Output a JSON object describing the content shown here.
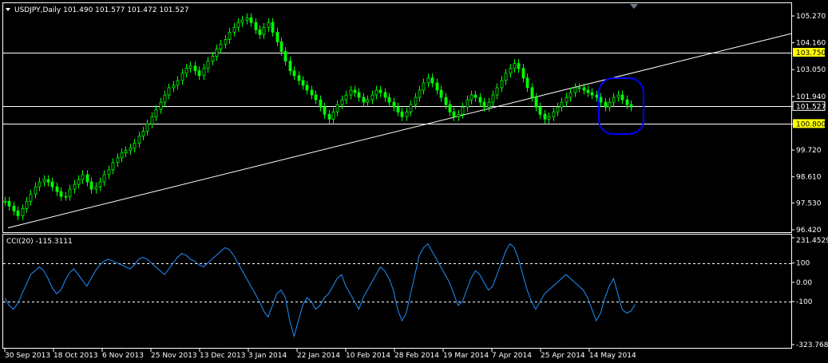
{
  "header": {
    "symbol_line": "USDJPY,Daily  101.490 101.577 101.472 101.527",
    "menu_arrow_icon": "triangle-down-icon"
  },
  "indicator": {
    "label": "CCI(20) -115.3111",
    "axis_labels": [
      "231.4529",
      "100",
      "0.00",
      "-100",
      "-323.768"
    ]
  },
  "price_axis": {
    "labels": [
      "105.270",
      "104.160",
      "103.050",
      "101.940",
      "101.527",
      "100.800",
      "99.720",
      "98.610",
      "97.530",
      "96.420"
    ],
    "highlighted": [
      "103.750",
      "100.800"
    ],
    "current_price_label": "101.527"
  },
  "time_axis": {
    "labels": [
      "30 Sep 2013",
      "18 Oct 2013",
      "6 Nov 2013",
      "25 Nov 2013",
      "13 Dec 2013",
      "3 Jan 2014",
      "22 Jan 2014",
      "10 Feb 2014",
      "28 Feb 2014",
      "19 Mar 2014",
      "7 Apr 2014",
      "25 Apr 2014",
      "14 May 2014"
    ]
  },
  "colors": {
    "background": "#000000",
    "candle": "#00ff00",
    "grid_line": "#ffffff",
    "cci_line": "#1e90ff",
    "annotation_circle": "#0000ff",
    "highlight_box": "#ffff00"
  },
  "chart_data": {
    "type": "line",
    "series": [
      {
        "name": "USDJPY",
        "values": [
          97.6,
          97.4,
          97.2,
          97.0,
          97.3,
          97.6,
          97.9,
          98.2,
          98.4,
          98.5,
          98.4,
          98.2,
          98.0,
          97.8,
          97.8,
          98.1,
          98.3,
          98.5,
          98.7,
          98.4,
          98.1,
          98.2,
          98.4,
          98.7,
          98.9,
          99.2,
          99.4,
          99.6,
          99.7,
          99.8,
          100.0,
          100.3,
          100.5,
          100.8,
          101.1,
          101.4,
          101.7,
          102.0,
          102.3,
          102.4,
          102.6,
          102.9,
          103.1,
          103.2,
          103.0,
          102.8,
          103.1,
          103.4,
          103.6,
          103.9,
          104.1,
          104.3,
          104.6,
          104.8,
          105.0,
          105.1,
          105.2,
          105.0,
          104.7,
          104.5,
          104.8,
          105.0,
          104.6,
          104.2,
          103.8,
          103.4,
          103.0,
          102.8,
          102.6,
          102.4,
          102.2,
          102.0,
          101.8,
          101.5,
          101.2,
          101.0,
          101.3,
          101.6,
          101.8,
          102.0,
          102.2,
          102.1,
          101.9,
          101.7,
          101.8,
          102.0,
          102.2,
          102.1,
          101.9,
          101.7,
          101.5,
          101.3,
          101.1,
          101.3,
          101.6,
          101.9,
          102.2,
          102.5,
          102.7,
          102.5,
          102.2,
          101.9,
          101.6,
          101.3,
          101.1,
          101.2,
          101.5,
          101.8,
          102.0,
          101.9,
          101.7,
          101.5,
          101.7,
          102.0,
          102.3,
          102.6,
          102.9,
          103.1,
          103.3,
          103.1,
          102.7,
          102.3,
          101.9,
          101.5,
          101.2,
          101.0,
          101.1,
          101.3,
          101.5,
          101.7,
          101.9,
          102.1,
          102.3,
          102.3,
          102.2,
          102.1,
          102.0,
          101.9,
          101.7,
          101.5,
          101.7,
          101.9,
          102.0,
          101.8,
          101.6,
          101.5
        ]
      },
      {
        "name": "CCI(20)",
        "values": [
          -80,
          -120,
          -140,
          -110,
          -60,
          -10,
          40,
          60,
          80,
          60,
          20,
          -30,
          -60,
          -40,
          10,
          50,
          70,
          40,
          10,
          -20,
          20,
          60,
          90,
          110,
          120,
          110,
          100,
          90,
          80,
          70,
          90,
          120,
          130,
          120,
          100,
          80,
          60,
          40,
          70,
          100,
          130,
          150,
          140,
          120,
          110,
          90,
          80,
          100,
          120,
          140,
          160,
          180,
          170,
          140,
          100,
          60,
          20,
          -20,
          -60,
          -100,
          -150,
          -180,
          -120,
          -60,
          -40,
          -80,
          -200,
          -280,
          -200,
          -120,
          -80,
          -100,
          -140,
          -120,
          -80,
          -60,
          -20,
          20,
          40,
          -20,
          -60,
          -100,
          -140,
          -80,
          -40,
          0,
          40,
          80,
          60,
          20,
          -40,
          -140,
          -200,
          -160,
          -60,
          40,
          140,
          180,
          200,
          160,
          120,
          80,
          40,
          0,
          -60,
          -120,
          -100,
          -40,
          20,
          60,
          40,
          0,
          -40,
          -20,
          40,
          100,
          160,
          200,
          180,
          120,
          40,
          -40,
          -100,
          -140,
          -100,
          -60,
          -40,
          -20,
          0,
          20,
          40,
          20,
          0,
          -20,
          -40,
          -80,
          -140,
          -200,
          -160,
          -80,
          -20,
          20,
          -60,
          -140,
          -160,
          -150,
          -115
        ]
      }
    ],
    "ylim": [
      96.42,
      105.7
    ],
    "cci_ylim": [
      -323.768,
      231.4529
    ],
    "horizontal_levels": [
      103.75,
      101.527,
      100.8
    ],
    "cci_levels": [
      100,
      -100
    ],
    "trendline": {
      "start": [
        0,
        96.5
      ],
      "end": [
        150,
        102.9
      ]
    },
    "grid": false
  }
}
